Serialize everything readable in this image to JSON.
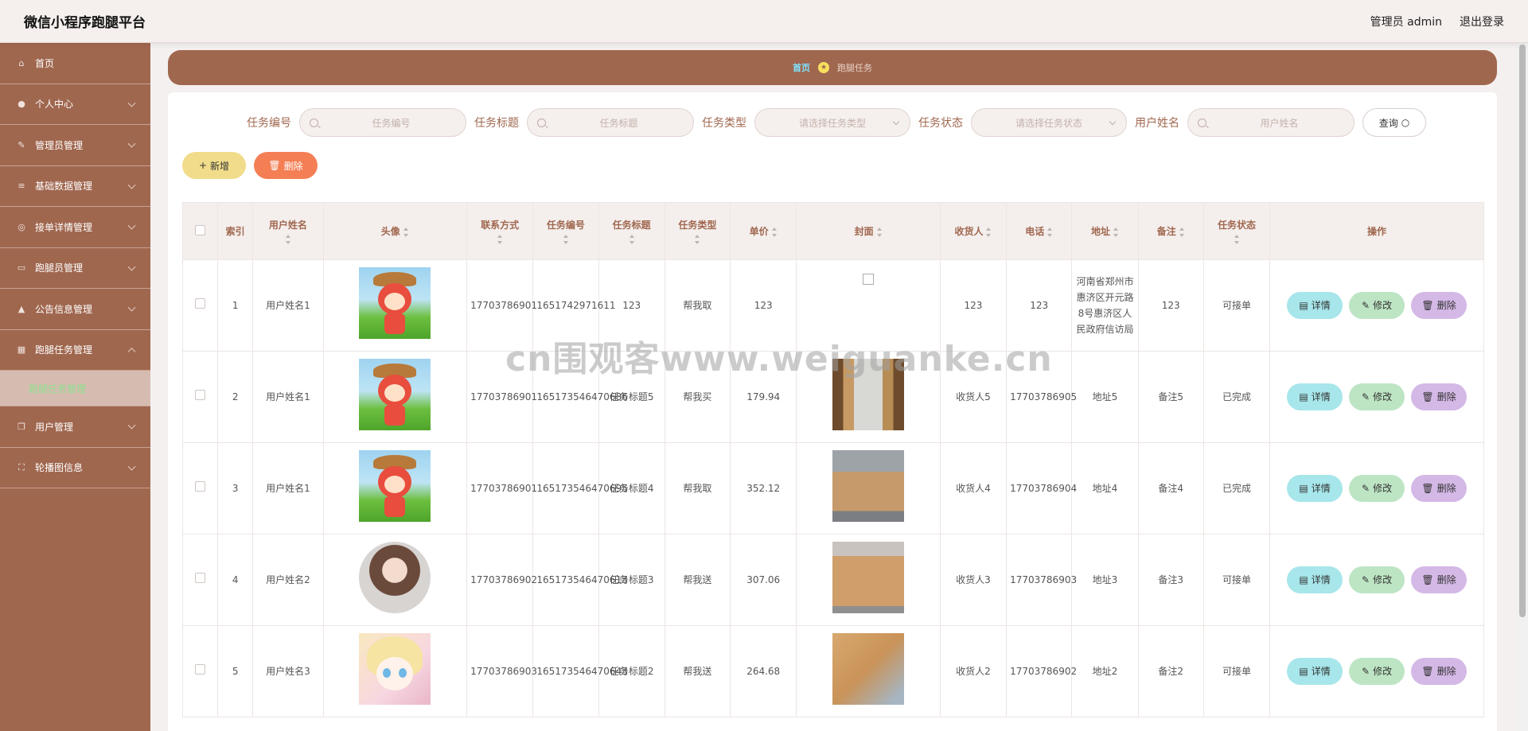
{
  "header": {
    "app_title": "微信小程序跑腿平台",
    "user_label": "管理员 admin",
    "logout": "退出登录"
  },
  "sidebar": {
    "items": [
      {
        "label": "首页",
        "icon": "home-icon"
      },
      {
        "label": "个人中心",
        "icon": "user-icon"
      },
      {
        "label": "管理员管理",
        "icon": "pencil-icon"
      },
      {
        "label": "基础数据管理",
        "icon": "list-icon"
      },
      {
        "label": "接单详情管理",
        "icon": "compass-icon"
      },
      {
        "label": "跑腿员管理",
        "icon": "monitor-icon"
      },
      {
        "label": "公告信息管理",
        "icon": "thumb-icon"
      },
      {
        "label": "跑腿任务管理",
        "icon": "bank-icon"
      },
      {
        "label": "用户管理",
        "icon": "copy-icon"
      },
      {
        "label": "轮播图信息",
        "icon": "crop-icon"
      }
    ],
    "active_sub": "跑腿任务管理"
  },
  "breadcrumb": {
    "home": "首页",
    "current": "跑腿任务"
  },
  "search": {
    "fields": [
      {
        "label": "任务编号",
        "placeholder": "任务编号",
        "type": "input"
      },
      {
        "label": "任务标题",
        "placeholder": "任务标题",
        "type": "input"
      },
      {
        "label": "任务类型",
        "placeholder": "请选择任务类型",
        "type": "select"
      },
      {
        "label": "任务状态",
        "placeholder": "请选择任务状态",
        "type": "select"
      },
      {
        "label": "用户姓名",
        "placeholder": "用户姓名",
        "type": "input"
      }
    ],
    "query_label": "查询"
  },
  "actions": {
    "add_label": "新增",
    "delete_label": "删除"
  },
  "table": {
    "columns": [
      "索引",
      "用户姓名",
      "头像",
      "联系方式",
      "任务编号",
      "任务标题",
      "任务类型",
      "单价",
      "封面",
      "收货人",
      "电话",
      "地址",
      "备注",
      "任务状态",
      "操作"
    ],
    "rows": [
      {
        "index": "1",
        "user": "用户姓名1",
        "avatar": "fox",
        "phone": "17703786901",
        "task_no": "1651742971611",
        "title": "123",
        "type": "帮我取",
        "price": "123",
        "cover": "broken",
        "receiver": "123",
        "tel": "123",
        "address": "河南省郑州市惠济区开元路8号惠济区人民政府信访局",
        "remark": "123",
        "status": "可接单"
      },
      {
        "index": "2",
        "user": "用户姓名1",
        "avatar": "fox",
        "phone": "17703786901",
        "task_no": "165173546470686",
        "title": "任务标题5",
        "type": "帮我买",
        "price": "179.94",
        "cover": "warehouse-1",
        "receiver": "收货人5",
        "tel": "17703786905",
        "address": "地址5",
        "remark": "备注5",
        "status": "已完成"
      },
      {
        "index": "3",
        "user": "用户姓名1",
        "avatar": "fox",
        "phone": "17703786901",
        "task_no": "165173546470695",
        "title": "任务标题4",
        "type": "帮我取",
        "price": "352.12",
        "cover": "warehouse-2",
        "receiver": "收货人4",
        "tel": "17703786904",
        "address": "地址4",
        "remark": "备注4",
        "status": "已完成"
      },
      {
        "index": "4",
        "user": "用户姓名2",
        "avatar": "girl",
        "phone": "17703786902",
        "task_no": "165173546470613",
        "title": "任务标题3",
        "type": "帮我送",
        "price": "307.06",
        "cover": "warehouse-3",
        "receiver": "收货人3",
        "tel": "17703786903",
        "address": "地址3",
        "remark": "备注3",
        "status": "可接单"
      },
      {
        "index": "5",
        "user": "用户姓名3",
        "avatar": "anime",
        "phone": "17703786903",
        "task_no": "165173546470643",
        "title": "任务标题2",
        "type": "帮我送",
        "price": "264.68",
        "cover": "warehouse-4",
        "receiver": "收货人2",
        "tel": "17703786902",
        "address": "地址2",
        "remark": "备注2",
        "status": "可接单"
      }
    ],
    "op_labels": {
      "detail": "详情",
      "edit": "修改",
      "remove": "删除"
    }
  },
  "watermark": "cn围观客www.weiguanke.cn",
  "colors": {
    "brand": "#a0674f",
    "accent_sub": "#8fe08f",
    "add": "#f0dc8a",
    "delete": "#f47f55"
  }
}
